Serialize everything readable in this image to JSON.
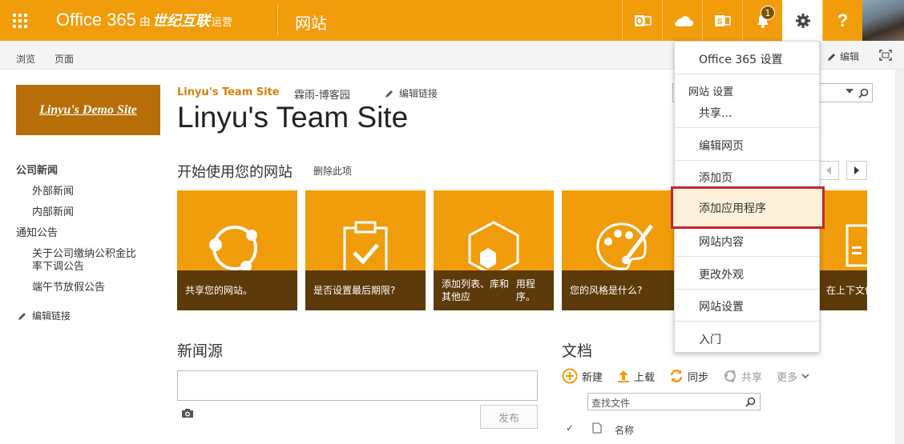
{
  "suitebar": {
    "brand_text": "Office 365",
    "brand_by": "由",
    "brand_partner": "世纪互联",
    "brand_operated": "运营",
    "site_label": "网站",
    "notification_count": "1",
    "colors": {
      "suite": "#f19c0a",
      "dark": "#5c3a0a"
    }
  },
  "ribbon": {
    "tabs": [
      "浏览",
      "页面"
    ],
    "edit_label": "编辑"
  },
  "site": {
    "logo_text": "Linyu's Demo Site",
    "breadcrumb_site": "Linyu's Team Site",
    "breadcrumb_sub": "霖雨-博客园",
    "edit_links": "编辑链接",
    "title": "Linyu's Team Site"
  },
  "quick_launch": {
    "items": [
      "公司新闻",
      "外部新闻",
      "内部新闻",
      "通知公告",
      "关于公司缴纳公积金比",
      "率下调公告",
      "端午节放假公告"
    ],
    "edit_links": "编辑链接"
  },
  "getting_started": {
    "title": "开始使用您的网站",
    "remove": "删除此项",
    "tiles": [
      "共享您的网站。",
      "是否设置最后期限?",
      "添加列表、库和其他应",
      "用程序。",
      "您的风格是什么?",
      "在上下文",
      "件。"
    ]
  },
  "newsfeed": {
    "title": "新闻源",
    "publish": "发布"
  },
  "documents": {
    "title": "文档",
    "commands": [
      "新建",
      "上载",
      "同步",
      "共享",
      "更多"
    ],
    "find_placeholder": "查找文件",
    "column_name": "名称"
  },
  "settings_menu": {
    "office_settings": "Office 365 设置",
    "site_settings_header": "网站 设置",
    "share": "共享...",
    "edit_page": "编辑网页",
    "add_page": "添加页",
    "add_app": "添加应用程序",
    "site_contents": "网站内容",
    "change_look": "更改外观",
    "site_settings": "网站设置",
    "getting_started": "入门"
  }
}
